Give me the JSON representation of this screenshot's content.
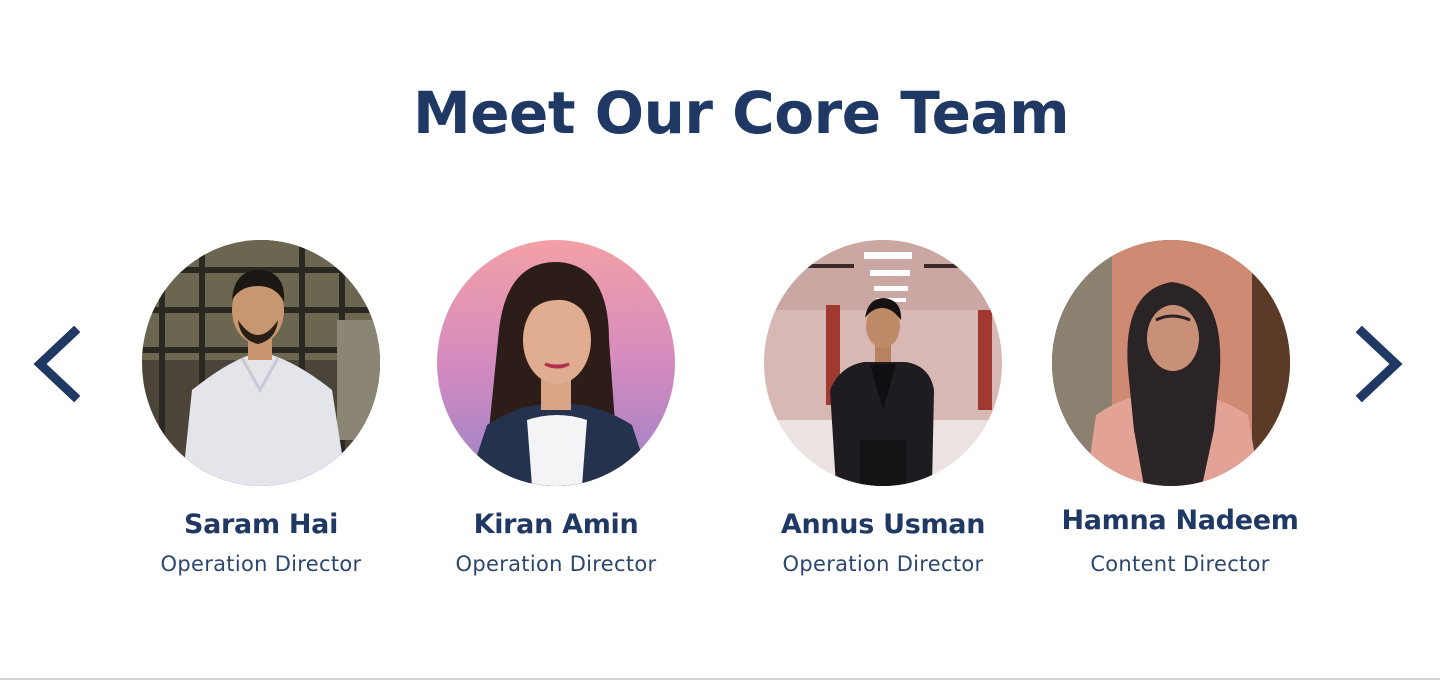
{
  "section": {
    "title": "Meet Our Core Team"
  },
  "carousel": {
    "prev_icon": "chevron-left-icon",
    "next_icon": "chevron-right-icon",
    "accent_color": "#1f3864"
  },
  "team": [
    {
      "name": "Saram Hai",
      "role": "Operation Director",
      "photo": "portrait-photo"
    },
    {
      "name": "Kiran Amin",
      "role": "Operation Director",
      "photo": "portrait-photo"
    },
    {
      "name": "Annus Usman",
      "role": "Operation Director",
      "photo": "portrait-photo"
    },
    {
      "name": "Hamna Nadeem",
      "role": "Content Director",
      "photo": "portrait-photo"
    }
  ]
}
